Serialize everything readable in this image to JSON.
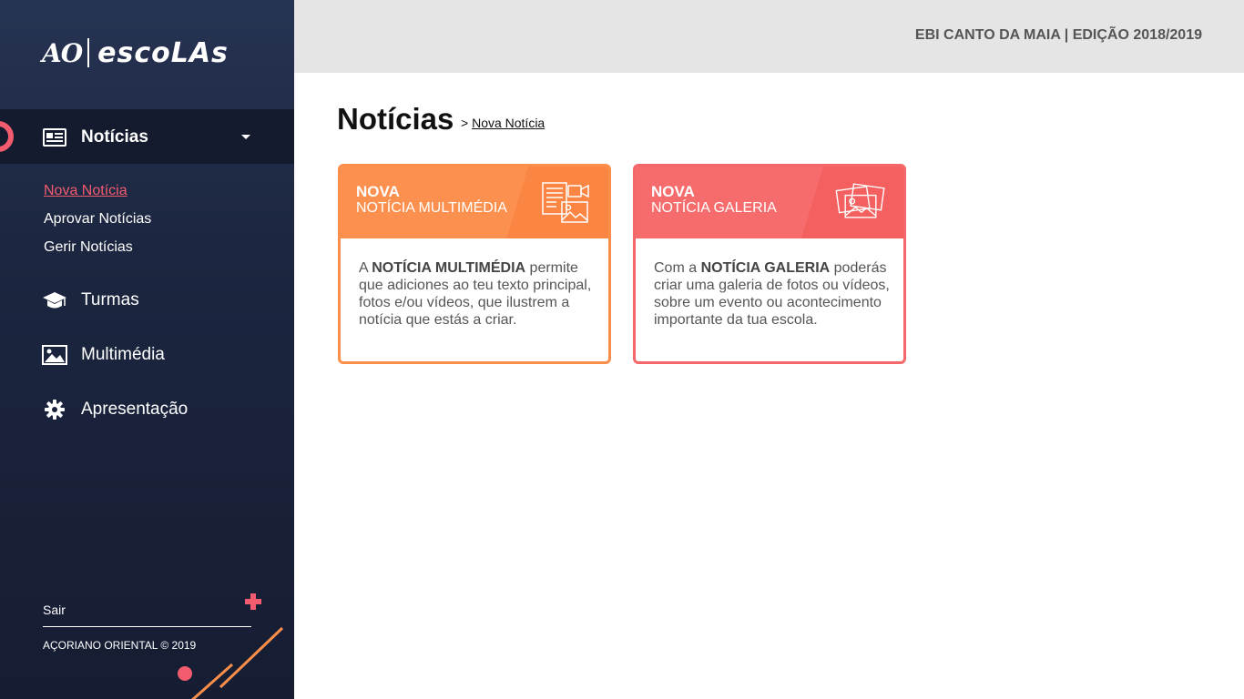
{
  "app": {
    "logo_ao": "AO",
    "logo_escolas": "escoLAs"
  },
  "header": {
    "school_edition": "EBI CANTO DA MAIA | EDIÇÃO 2018/2019"
  },
  "sidebar": {
    "items": [
      {
        "label": "Notícias",
        "icon": "newspaper-icon",
        "active": true
      },
      {
        "label": "Turmas",
        "icon": "graduation-cap-icon"
      },
      {
        "label": "Multimédia",
        "icon": "image-icon"
      },
      {
        "label": "Apresentação",
        "icon": "gear-icon"
      }
    ],
    "sub_items": [
      {
        "label": "Nova Notícia",
        "active": true
      },
      {
        "label": "Aprovar Notícias"
      },
      {
        "label": "Gerir Notícias"
      }
    ],
    "logout_label": "Sair",
    "copyright": "AÇORIANO ORIENTAL © 2019",
    "accent_color": "#f25c6e"
  },
  "main": {
    "title": "Notícias",
    "breadcrumb_sep": ">",
    "breadcrumb_current": "Nova Notícia",
    "cards": [
      {
        "title_line1": "NOVA",
        "title_line2": "NOTÍCIA MULTIMÉDIA",
        "icon": "multimedia-news-icon",
        "color": "#fc914f",
        "body_prefix": "A ",
        "body_bold": "NOTÍCIA MULTIMÉDIA",
        "body_suffix": " permite que adiciones ao teu texto principal,  fotos e/ou vídeos, que ilustrem a notícia que estás a criar."
      },
      {
        "title_line1": "NOVA",
        "title_line2": "NOTÍCIA GALERIA",
        "icon": "photo-gallery-icon",
        "color": "#f66c6c",
        "body_prefix": "Com a ",
        "body_bold": "NOTÍCIA GALERIA",
        "body_suffix": " poderás criar uma galeria de fotos ou vídeos, sobre um evento ou acontecimento importante da tua escola."
      }
    ]
  }
}
